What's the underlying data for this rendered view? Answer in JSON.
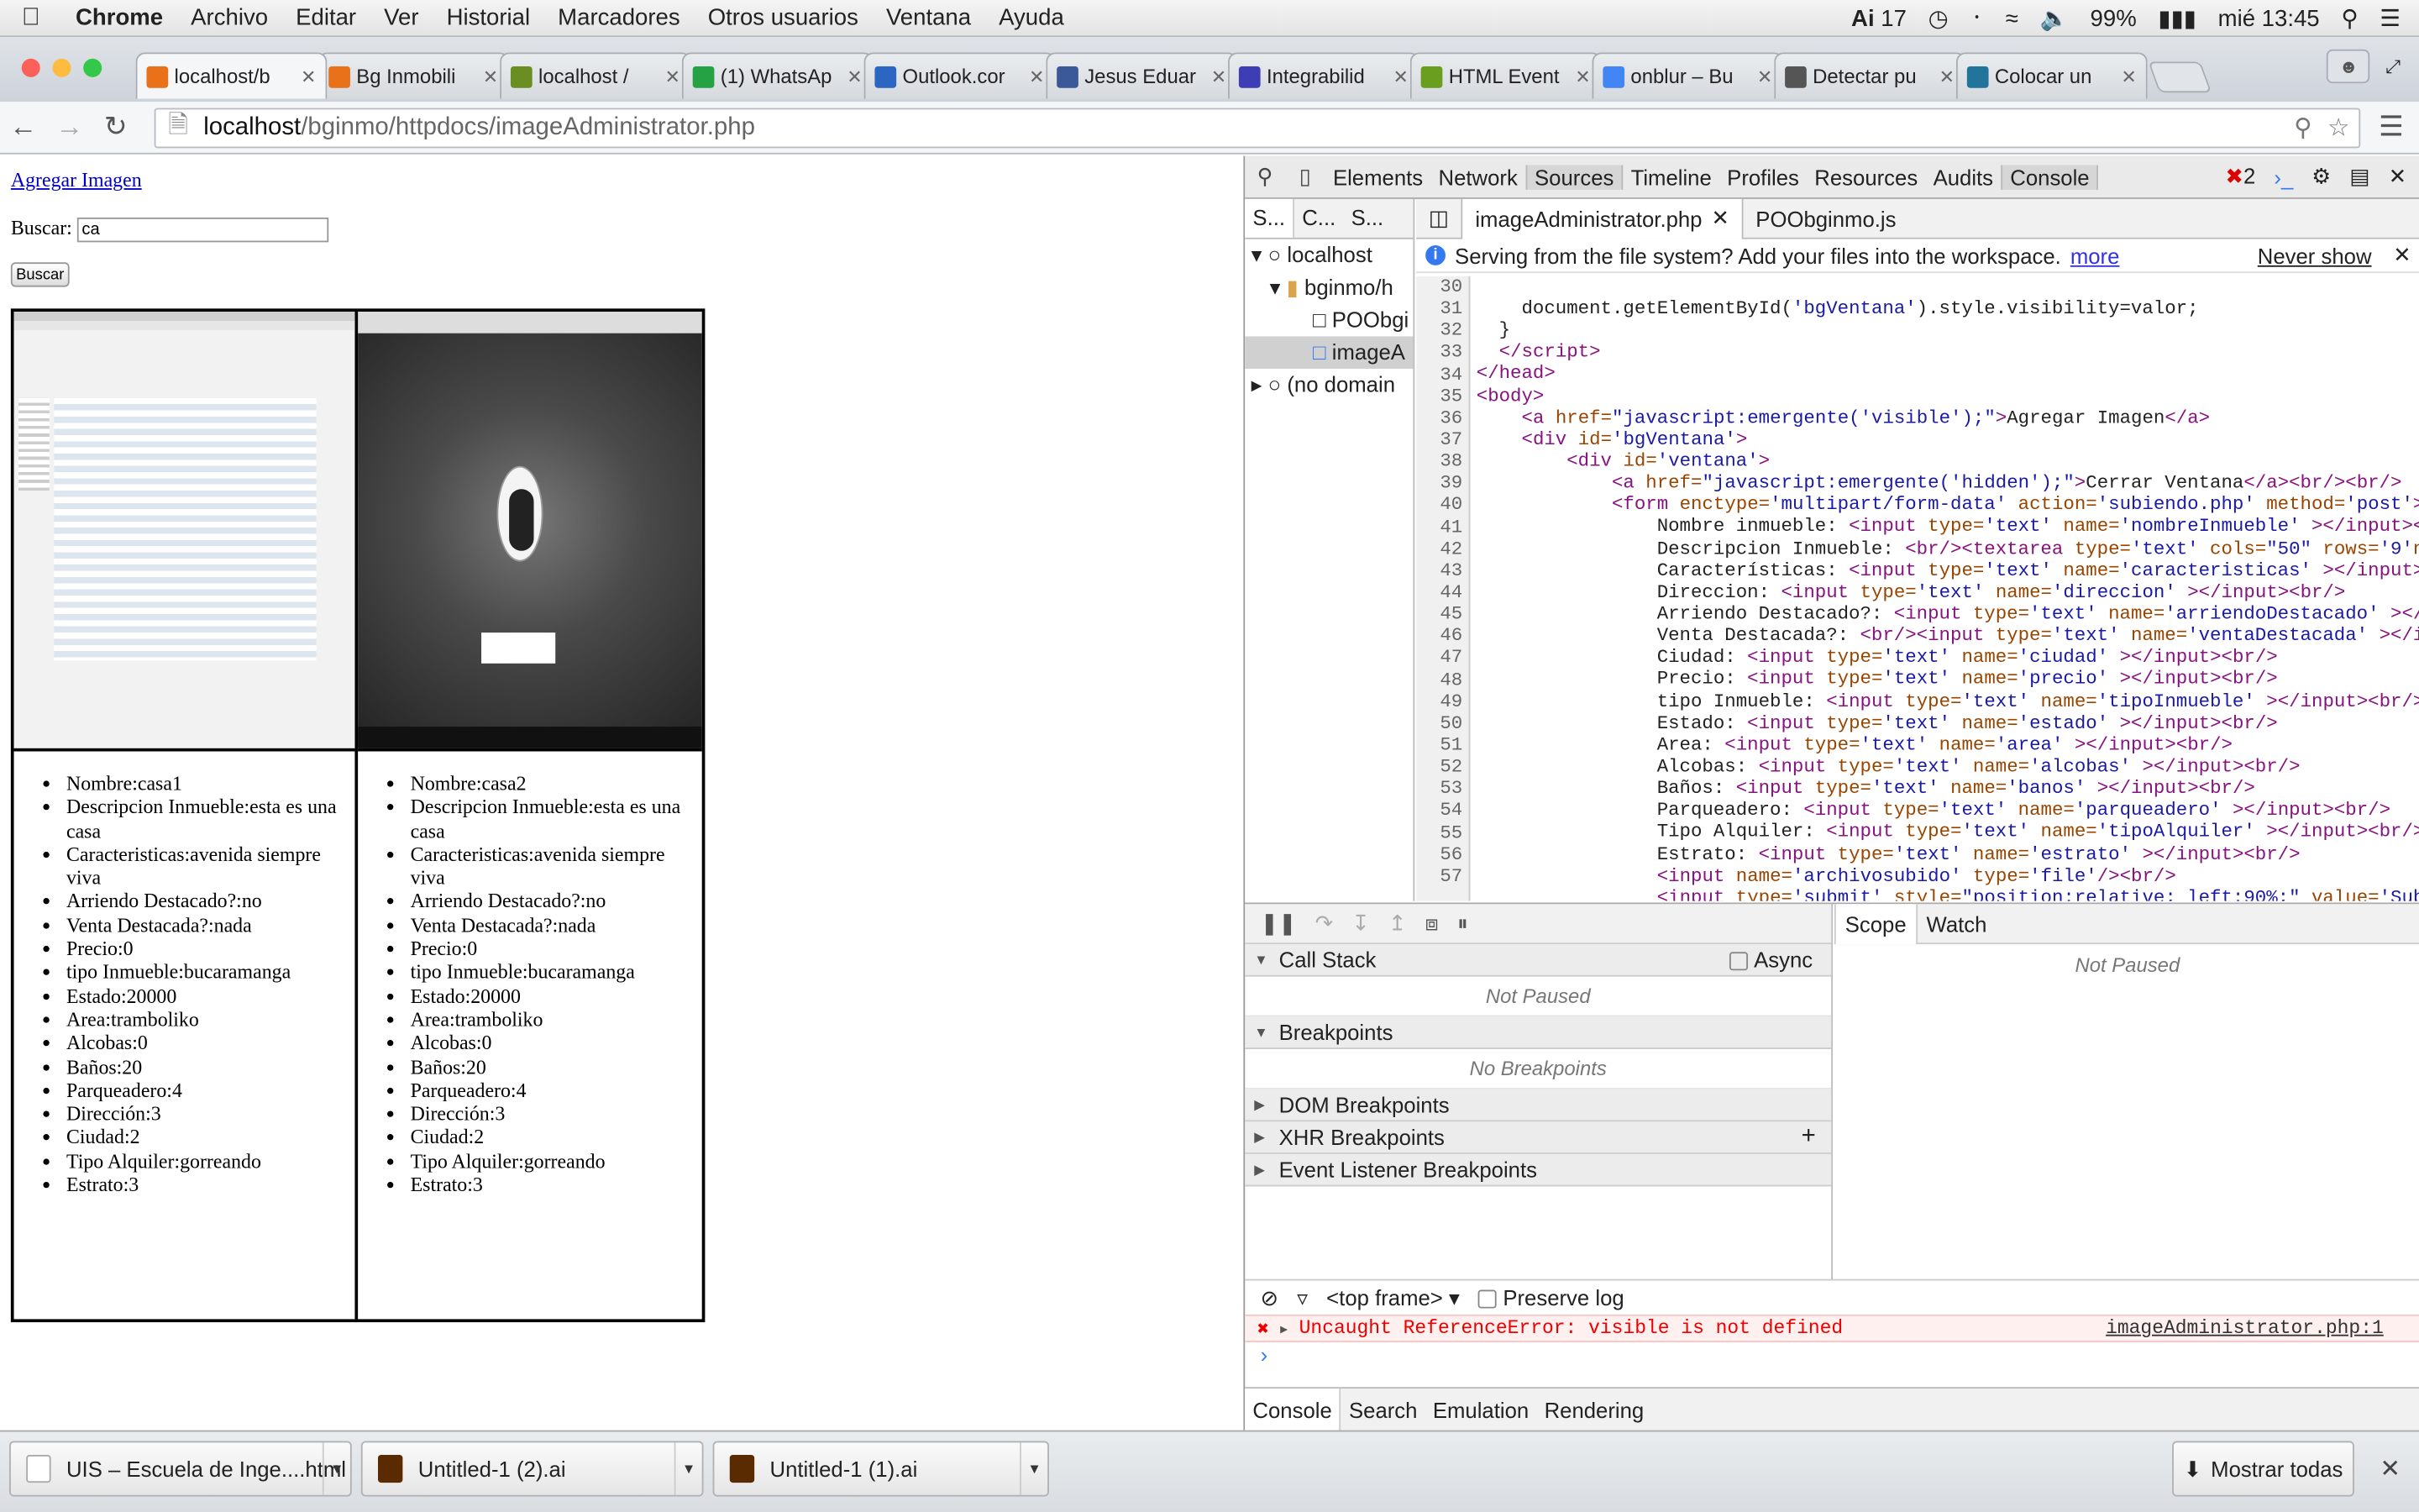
{
  "menubar": {
    "app": "Chrome",
    "items": [
      "Archivo",
      "Editar",
      "Ver",
      "Historial",
      "Marcadores",
      "Otros usuarios",
      "Ventana",
      "Ayuda"
    ],
    "status": {
      "ai_badge": "17",
      "battery": "99%",
      "clock": "mié 13:45"
    }
  },
  "tabs": [
    {
      "label": "localhost/b",
      "favicon_color": "#e8711a",
      "active": true
    },
    {
      "label": "Bg Inmobili",
      "favicon_color": "#e8711a"
    },
    {
      "label": "localhost /",
      "favicon_color": "#6b8e23"
    },
    {
      "label": "(1) WhatsAp",
      "favicon_color": "#25a244"
    },
    {
      "label": "Outlook.cor",
      "favicon_color": "#2a66c2"
    },
    {
      "label": "Jesus Eduar",
      "favicon_color": "#3b5998"
    },
    {
      "label": "Integrabilid",
      "favicon_color": "#3d3db5"
    },
    {
      "label": "HTML Event",
      "favicon_color": "#6a9e1f"
    },
    {
      "label": "onblur – Bu",
      "favicon_color": "#4285f4"
    },
    {
      "label": "Detectar pu",
      "favicon_color": "#555555"
    },
    {
      "label": "Colocar un",
      "favicon_color": "#21759b"
    }
  ],
  "address": {
    "host": "localhost",
    "path": "/bginmo/httpdocs/imageAdministrator.php"
  },
  "page": {
    "add_link": "Agregar Imagen",
    "search_label": "Buscar:",
    "search_value": "ca",
    "search_button": "Buscar",
    "cards": [
      {
        "items": [
          "Nombre:casa1",
          "Descripcion Inmueble:esta es una casa",
          "Caracteristicas:avenida siempre viva",
          "Arriendo Destacado?:no",
          "Venta Destacada?:nada",
          "Precio:0",
          "tipo Inmueble:bucaramanga",
          "Estado:20000",
          "Area:tramboliko",
          "Alcobas:0",
          "Baños:20",
          "Parqueadero:4",
          "Dirección:3",
          "Ciudad:2",
          "Tipo Alquiler:gorreando",
          "Estrato:3"
        ]
      },
      {
        "items": [
          "Nombre:casa2",
          "Descripcion Inmueble:esta es una casa",
          "Caracteristicas:avenida siempre viva",
          "Arriendo Destacado?:no",
          "Venta Destacada?:nada",
          "Precio:0",
          "tipo Inmueble:bucaramanga",
          "Estado:20000",
          "Area:tramboliko",
          "Alcobas:0",
          "Baños:20",
          "Parqueadero:4",
          "Dirección:3",
          "Ciudad:2",
          "Tipo Alquiler:gorreando",
          "Estrato:3"
        ]
      }
    ]
  },
  "devtools": {
    "tabs": [
      "Elements",
      "Network",
      "Sources",
      "Timeline",
      "Profiles",
      "Resources",
      "Audits",
      "Console"
    ],
    "selected_tab": "Sources",
    "error_count": "2",
    "nav_tabs": [
      "S...",
      "C...",
      "S..."
    ],
    "tree": [
      "localhost",
      "bginmo/h",
      "POObgi",
      "imageA",
      "(no domain"
    ],
    "editor_tabs": [
      "imageAdministrator.php",
      "POObginmo.js"
    ],
    "info": {
      "text": "Serving from the file system? Add your files into the workspace.",
      "more": "more",
      "never_show": "Never show"
    },
    "line_numbers": [
      "30",
      "31",
      "32",
      "33",
      "34",
      "35",
      "36",
      "37",
      "38",
      "39",
      "40",
      "41",
      "42",
      "43",
      "44",
      "45",
      "46",
      "47",
      "48",
      "49",
      "50",
      "51",
      "52",
      "53",
      "54",
      "55",
      "56",
      "57"
    ],
    "debugger": {
      "call_stack": "Call Stack",
      "async": "Async",
      "not_paused": "Not Paused",
      "breakpoints": "Breakpoints",
      "no_breakpoints": "No Breakpoints",
      "dom_bp": "DOM Breakpoints",
      "xhr_bp": "XHR Breakpoints",
      "event_bp": "Event Listener Breakpoints",
      "scope": "Scope",
      "watch": "Watch"
    },
    "console": {
      "frame": "<top frame>",
      "preserve": "Preserve log",
      "error": "Uncaught ReferenceError: visible is not defined",
      "source": "imageAdministrator.php:1"
    },
    "drawer_tabs": [
      "Console",
      "Search",
      "Emulation",
      "Rendering"
    ]
  },
  "downloads": [
    {
      "name": "UIS – Escuela de Inge....html",
      "icon_color": "#ffffff"
    },
    {
      "name": "Untitled-1 (2).ai",
      "icon_color": "#5a2a00"
    },
    {
      "name": "Untitled-1 (1).ai",
      "icon_color": "#5a2a00"
    }
  ],
  "show_all": "Mostrar todas"
}
